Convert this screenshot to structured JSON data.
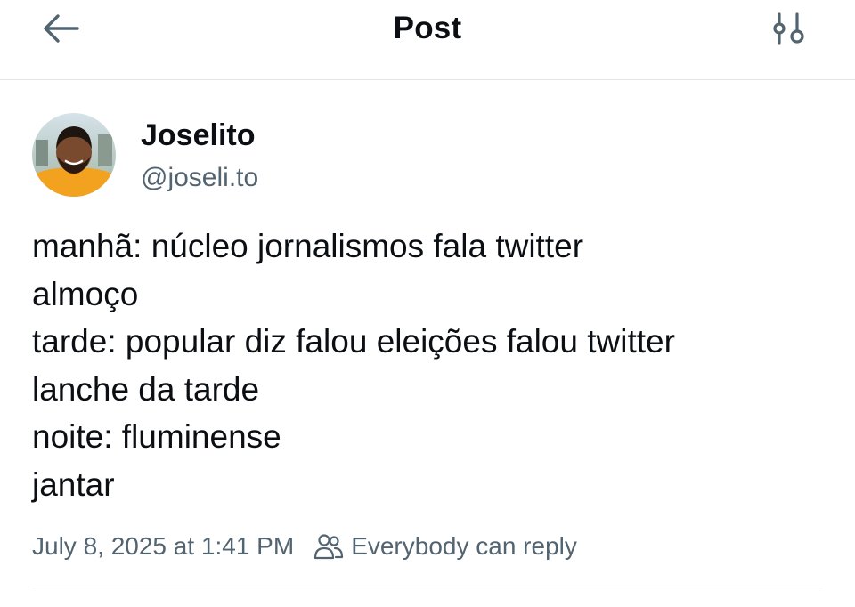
{
  "header": {
    "title": "Post",
    "back_icon": "arrow-left-icon",
    "filter_icon": "sliders-icon"
  },
  "author": {
    "name": "Joselito",
    "handle": "@joseli.to"
  },
  "post": {
    "lines": [
      "manhã: núcleo jornalismos fala twitter",
      "almoço",
      "tarde: popular diz falou eleições falou twitter",
      "lanche da tarde",
      "noite: fluminense",
      "jantar"
    ]
  },
  "meta": {
    "timestamp": "July 8, 2025 at 1:41 PM",
    "reply_setting": "Everybody can reply",
    "reply_icon": "people-icon"
  },
  "colors": {
    "text": "#0b0f14",
    "secondary": "#536471",
    "divider": "#e3e6e9",
    "icon": "#536471"
  }
}
